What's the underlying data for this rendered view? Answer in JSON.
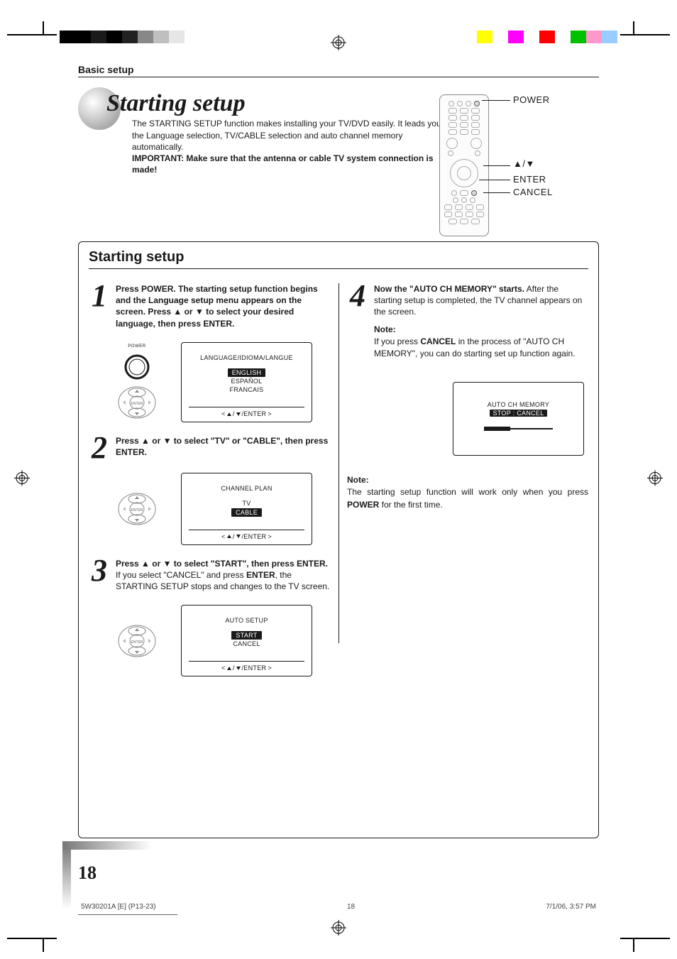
{
  "header": {
    "section": "Basic setup"
  },
  "title": "Starting setup",
  "intro": {
    "body": "The STARTING SETUP function makes installing your TV/DVD easily. It leads you the Language selection, TV/CABLE selection and auto channel memory automatically.",
    "important": "IMPORTANT: Make sure that the antenna or cable TV system connection is made!"
  },
  "remote_labels": {
    "power": "POWER",
    "arrows": "▲/▼",
    "enter": "ENTER",
    "cancel": "CANCEL"
  },
  "proc": {
    "title": "Starting setup",
    "steps": [
      {
        "num": "1",
        "lead": "Press POWER.",
        "bold_rest": "The starting setup function begins and the Language setup menu appears on the screen. Press ▲ or ▼ to select your desired language, then press ENTER.",
        "osd": {
          "title": "LANGUAGE/IDIOMA/LANGUE",
          "items": [
            {
              "label": "ENGLISH",
              "selected": true
            },
            {
              "label": "ESPAÑOL",
              "selected": false
            },
            {
              "label": "FRANCAIS",
              "selected": false
            }
          ],
          "hint_enter": "/ENTER"
        },
        "show_power": true,
        "power_label": "POWER"
      },
      {
        "num": "2",
        "lead": "Press ▲ or ▼ to select \"TV\" or \"CABLE\", then press ENTER.",
        "osd": {
          "title": "CHANNEL PLAN",
          "items": [
            {
              "label": "TV",
              "selected": false
            },
            {
              "label": "CABLE",
              "selected": true
            }
          ],
          "hint_enter": "/ENTER"
        }
      },
      {
        "num": "3",
        "lead": "Press ▲ or ▼ to select \"START\", then press ENTER.",
        "sub_html": "If you select \"CANCEL\" and press <b>ENTER</b>, the STARTING SETUP stops and changes to the TV screen.",
        "osd": {
          "title": "AUTO SETUP",
          "items": [
            {
              "label": "START",
              "selected": true
            },
            {
              "label": "CANCEL",
              "selected": false
            }
          ],
          "hint_enter": "/ENTER"
        }
      },
      {
        "num": "4",
        "lead": "Now the \"AUTO CH MEMORY\" starts.",
        "sub": "After the starting setup is completed, the TV channel appears on the screen.",
        "note_label": "Note:",
        "note_html": "If you press <b>CANCEL</b> in the process of \"AUTO CH MEMORY\", you can do starting set up function again.",
        "osd": {
          "title": "AUTO CH MEMORY",
          "subtitle": "STOP : CANCEL",
          "progress": true
        }
      }
    ],
    "bottom_note": {
      "label": "Note:",
      "html": "The starting setup function will work only when you press <b>POWER</b> for the first time."
    }
  },
  "page_number": "18",
  "footer": {
    "file": "5W30201A [E] (P13-23)",
    "page": "18",
    "date": "7/1/06, 3:57 PM"
  }
}
